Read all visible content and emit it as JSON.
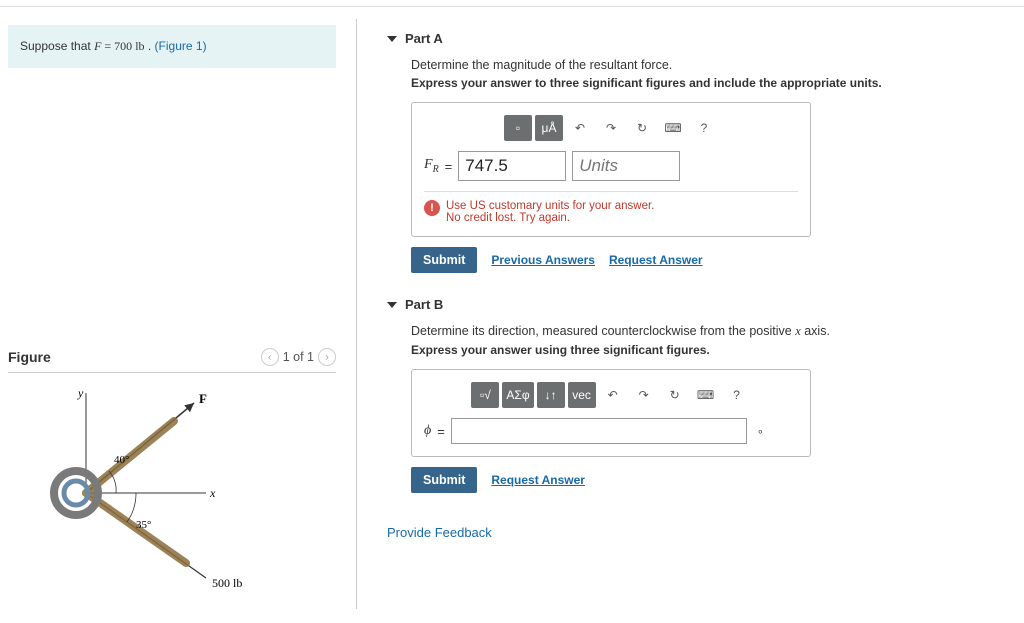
{
  "prompt": {
    "prefix": "Suppose that ",
    "var": "F",
    "eq": " = 700 ",
    "unit": "lb",
    "suffix": " . ",
    "figlink": "(Figure 1)"
  },
  "figure": {
    "title": "Figure",
    "pager": "1 of 1",
    "labels": {
      "y": "y",
      "x": "x",
      "F": "F",
      "a40": "40°",
      "a35": "35°",
      "load": "500 lb"
    }
  },
  "partA": {
    "title": "Part A",
    "question": "Determine the magnitude of the resultant force.",
    "instructions": "Express your answer to three significant figures and include the appropriate units.",
    "toolbar": {
      "t1": "▫",
      "t2": "μÅ",
      "undo": "↶",
      "redo": "↷",
      "reset": "↻",
      "kb": "⌨",
      "help": "?"
    },
    "var": "F",
    "sub": "R",
    "eq": "=",
    "value": "747.5",
    "units_placeholder": "Units",
    "feedback_line1": "Use US customary units for your answer.",
    "feedback_line2": "No credit lost. Try again.",
    "submit": "Submit",
    "prev": "Previous Answers",
    "req": "Request Answer"
  },
  "partB": {
    "title": "Part B",
    "question_prefix": "Determine its direction, measured counterclockwise from the positive ",
    "question_var": "x",
    "question_suffix": " axis.",
    "instructions": "Express your answer using three significant figures.",
    "toolbar": {
      "t1": "▫√",
      "t2": "ΑΣφ",
      "t3": "↓↑",
      "t4": "vec",
      "undo": "↶",
      "redo": "↷",
      "reset": "↻",
      "kb": "⌨",
      "help": "?"
    },
    "var": "ϕ",
    "eq": "=",
    "value": "",
    "unit_badge": "∘",
    "submit": "Submit",
    "req": "Request Answer"
  },
  "footer": {
    "provide": "Provide Feedback"
  }
}
